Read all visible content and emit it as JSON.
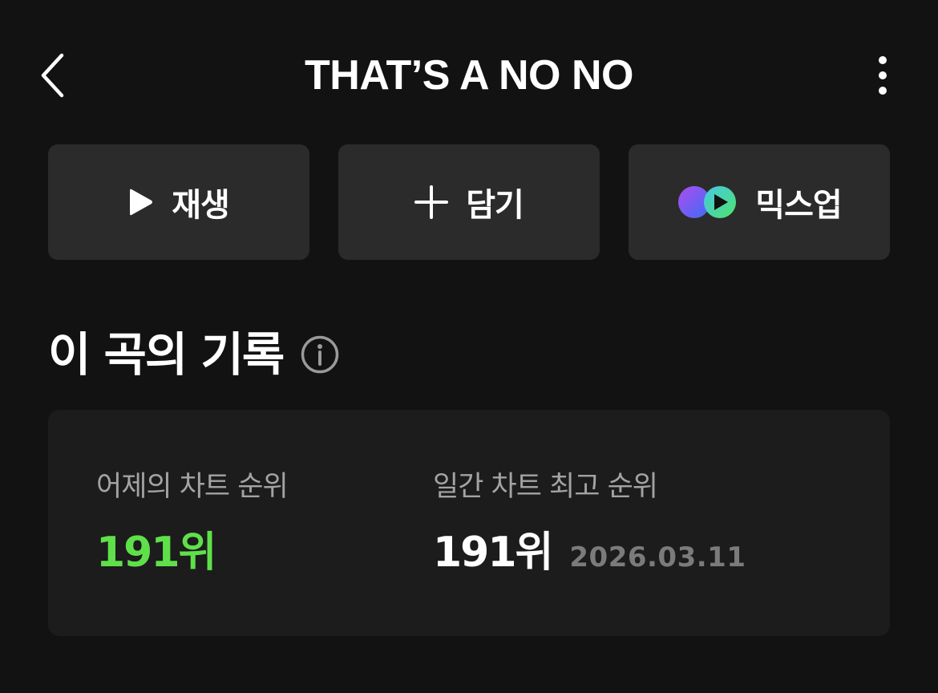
{
  "header": {
    "title": "THAT’S A NO NO",
    "back_icon": "chevron-left-icon",
    "more_icon": "more-vertical-icon"
  },
  "actions": [
    {
      "label": "재생",
      "icon": "play-icon"
    },
    {
      "label": "담기",
      "icon": "plus-icon"
    },
    {
      "label": "믹스업",
      "icon": "mixup-icon"
    }
  ],
  "section": {
    "title": "이 곡의 기록",
    "info_icon": "info-icon"
  },
  "record": {
    "yesterday_label": "어제의 차트 순위",
    "yesterday_value": "191위",
    "peak_label": "일간 차트 최고 순위",
    "peak_value": "191위",
    "peak_date": "2026.03.11"
  },
  "colors": {
    "background": "#121212",
    "button": "#2b2b2b",
    "card": "#1c1c1c",
    "accent_green": "#5fe04a",
    "label_gray": "#a3a3a3",
    "date_gray": "#7b7b7b"
  }
}
